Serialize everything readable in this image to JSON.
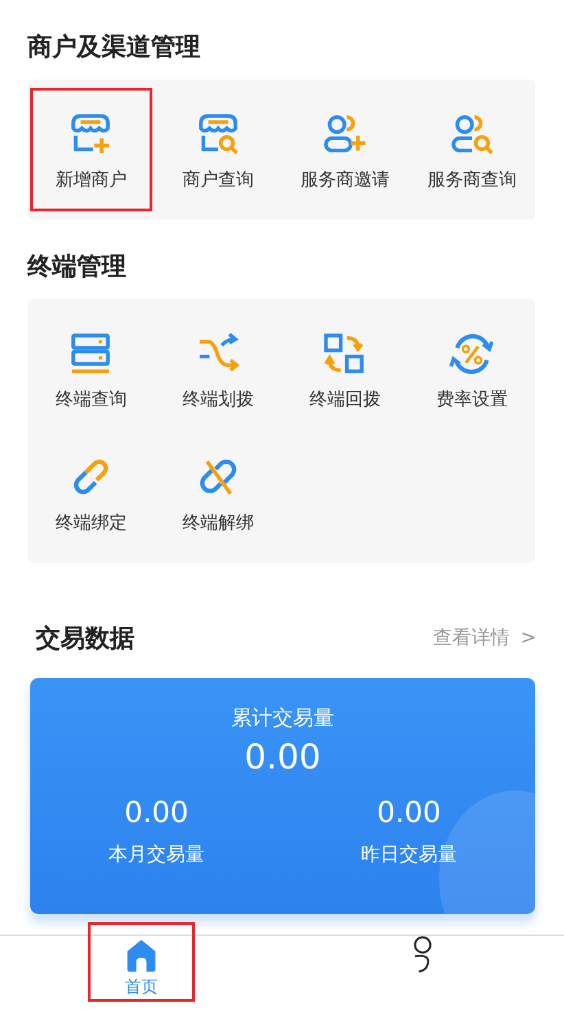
{
  "sections": [
    {
      "title": "商户及渠道管理",
      "items": [
        {
          "label": "新增商户",
          "highlighted": true
        },
        {
          "label": "商户查询",
          "highlighted": false
        },
        {
          "label": "服务商邀请",
          "highlighted": false
        },
        {
          "label": "服务商查询",
          "highlighted": false
        }
      ]
    },
    {
      "title": "终端管理",
      "items": [
        {
          "label": "终端查询",
          "highlighted": false
        },
        {
          "label": "终端划拨",
          "highlighted": false
        },
        {
          "label": "终端回拨",
          "highlighted": false
        },
        {
          "label": "费率设置",
          "highlighted": false
        },
        {
          "label": "终端绑定",
          "highlighted": false
        },
        {
          "label": "终端解绑",
          "highlighted": false
        }
      ]
    }
  ],
  "trade": {
    "title": "交易数据",
    "link": "查看详情",
    "link_arrow": ">",
    "total_label": "累计交易量",
    "total_value": "0.00",
    "stats": [
      {
        "value": "0.00",
        "label": "本月交易量"
      },
      {
        "value": "0.00",
        "label": "昨日交易量"
      }
    ]
  },
  "tab_bar": [
    {
      "label": "首页",
      "selected": true,
      "highlighted": true
    },
    {
      "selected": false,
      "highlighted": false
    }
  ]
}
